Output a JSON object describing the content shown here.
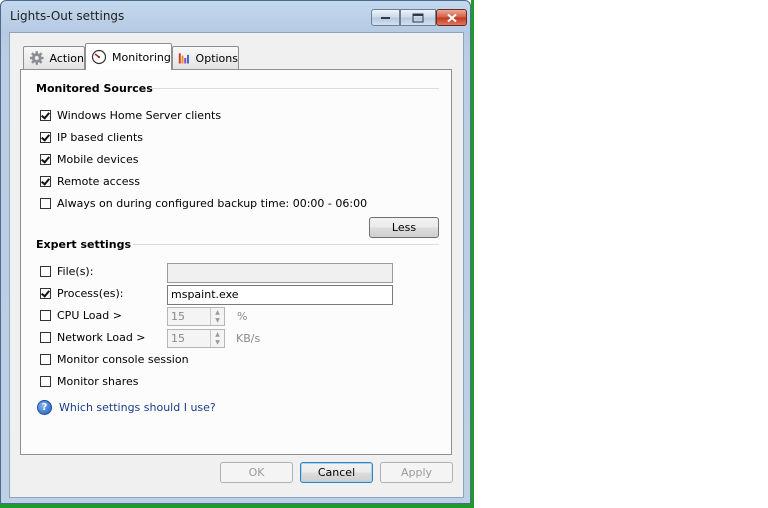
{
  "window": {
    "title": "Lights-Out settings"
  },
  "tabs": [
    {
      "label": "Action",
      "icon": "gear-icon"
    },
    {
      "label": "Monitoring",
      "icon": "gauge-icon"
    },
    {
      "label": "Options",
      "icon": "bar-chart-icon"
    }
  ],
  "monitored_sources": {
    "heading": "Monitored Sources",
    "items": [
      {
        "label": "Windows Home Server clients",
        "checked": true
      },
      {
        "label": "IP based clients",
        "checked": true
      },
      {
        "label": "Mobile devices",
        "checked": true
      },
      {
        "label": "Remote access",
        "checked": true
      },
      {
        "label": "Always on during configured backup time: 00:00 - 06:00",
        "checked": false
      }
    ],
    "less_button": "Less"
  },
  "expert_settings": {
    "heading": "Expert settings",
    "files": {
      "label": "File(s):",
      "checked": false,
      "value": ""
    },
    "processes": {
      "label": "Process(es):",
      "checked": true,
      "value": "mspaint.exe"
    },
    "cpu_load": {
      "label": "CPU Load >",
      "checked": false,
      "value": "15",
      "unit": "%"
    },
    "network_load": {
      "label": "Network Load >",
      "checked": false,
      "value": "15",
      "unit": "KB/s"
    },
    "console_session": {
      "label": "Monitor console session",
      "checked": false
    },
    "shares": {
      "label": "Monitor shares",
      "checked": false
    }
  },
  "help": {
    "link": "Which settings should I use?"
  },
  "footer": {
    "ok": "OK",
    "cancel": "Cancel",
    "apply": "Apply"
  },
  "colors": {
    "accent": "#1a3c8e",
    "window_frame": "#b9cde4",
    "close_button": "#c4391f"
  }
}
